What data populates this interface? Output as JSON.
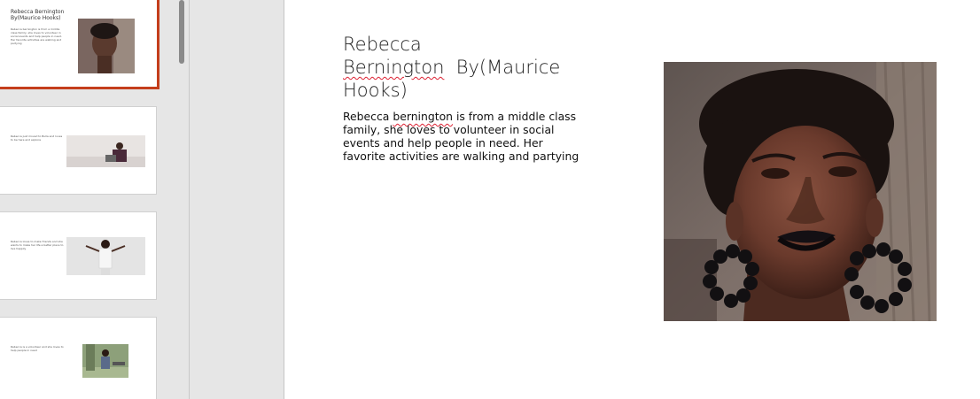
{
  "thumbnails": [
    {
      "title": "Rebecca Bernington By(Maurice Hooks)",
      "body": "Rebecca bernington is from a middle class family, she loves to volunteer in social events and help people in need. Her favorite activities are walking and partying",
      "selected": true
    },
    {
      "body": "Rebecca just moved to Bulla and loves to be here and explore"
    },
    {
      "body": "Rebecca loves to make friends and she wants to make her life a better place to live happily"
    },
    {
      "body": "Rebecca is a volunteer and she loves to help people in need"
    }
  ],
  "slide": {
    "title_line1": "Rebecca",
    "title_word_bernington": "Bernington",
    "title_rest": "  By(Maurice",
    "title_line3": "Hooks)",
    "body_pre": "Rebecca ",
    "body_squiggle": "bernington",
    "body_post": " is from a middle class family, she loves to volunteer in social events and help people in need. Her favorite activities are walking and partying"
  },
  "colors": {
    "selection": "#c43e1c",
    "panel": "#e6e6e6",
    "spellcheck": "#dd2233"
  }
}
